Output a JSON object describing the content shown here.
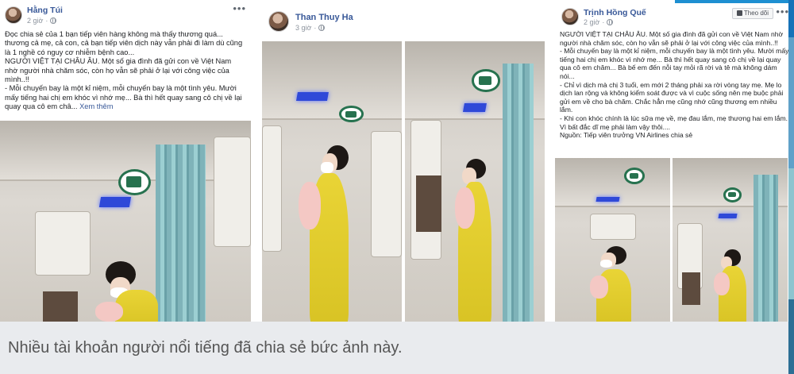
{
  "posts": [
    {
      "author": "Hằng Túi",
      "time": "2 giờ",
      "text": [
        "Đọc chia sẻ của 1 bạn tiếp viên hàng không mà thấy thương quá... thương cả mẹ, cả con, cả bạn tiếp viên dịch này vẫn phải đi làm dù cũng là 1 nghề có nguy cơ nhiễm bệnh cao...",
        "NGƯỜI VIỆT TẠI CHÂU ÂU. Một số gia đình đã gửi con về Việt Nam nhờ người nhà chăm sóc, còn họ vẫn sẽ phải ở lại với công việc của mình..!!",
        "- Mỗi chuyến bay là một kỉ niệm, mỗi chuyến bay là một tình yêu. Mười mấy tiếng hai chị em khóc vì nhớ mẹ... Bà thì hết quay sang cô chị về lại quay qua cô em châ..."
      ],
      "see_more": "Xem thêm"
    },
    {
      "author": "Than Thuy Ha",
      "time": "3 giờ"
    },
    {
      "author": "Trịnh Hồng Quế",
      "time": "2 giờ",
      "follow_label": "Theo dõi",
      "text": [
        "NGƯỜI VIỆT TẠI CHÂU ÂU. Một số gia đình đã gửi con về Việt Nam nhờ người nhà chăm sóc, còn họ vẫn sẽ phải ở lại với công việc của mình..!!",
        "- Mỗi chuyến bay là một kỉ niệm, mỗi chuyến bay là một tình yêu. Mười mấy tiếng hai chị em khóc vì nhớ mẹ... Bà thì hết quay sang cô chị về lại quay qua cô em chăm... Bà bế em đến nỗi tay mỏi rã rời và tê mà không dám nói...",
        "- Chỉ vì dịch mà chị 3 tuổi, em mới 2 tháng phải xa rời vòng tay mẹ. Mẹ lo dịch lan rộng và không kiểm soát được và vì cuộc sống nên mẹ buộc phải gửi em về cho bà chăm. Chắc hẳn mẹ cũng nhớ cũng thương em nhiều lắm.",
        "- Khi con khóc chính là lúc sữa mẹ về, mẹ đau lắm, mẹ thương hai em lắm. Vì bất đắc dĩ mẹ phải làm vậy thôi....",
        "Nguồn: Tiếp viên trưởng VN Airlines chia sẻ"
      ]
    }
  ],
  "caption": "Nhiều tài khoản người nổi tiếng đã chia sẻ bức ảnh này."
}
